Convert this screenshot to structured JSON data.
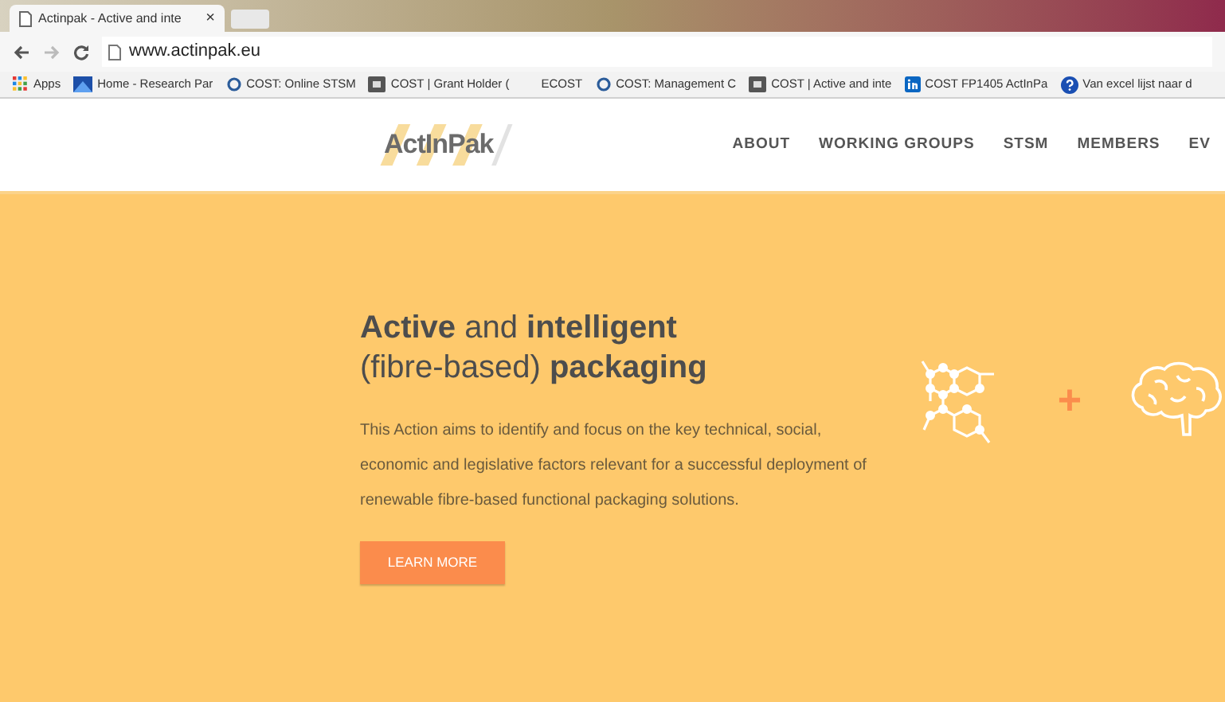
{
  "browser": {
    "tab": {
      "title": "Actinpak - Active and inte",
      "close": "×"
    },
    "url": "www.actinpak.eu",
    "bookmarks": [
      {
        "label": "Apps",
        "kind": "apps"
      },
      {
        "label": "Home - Research Par",
        "kind": "blue"
      },
      {
        "label": "COST: Online STSM",
        "kind": "ring"
      },
      {
        "label": "COST | Grant Holder (",
        "kind": "square"
      },
      {
        "label": "ECOST",
        "kind": "none"
      },
      {
        "label": "COST: Management C",
        "kind": "ring"
      },
      {
        "label": "COST | Active and inte",
        "kind": "square"
      },
      {
        "label": "COST FP1405 ActInPa",
        "kind": "linkedin"
      },
      {
        "label": "Van excel lijst naar d",
        "kind": "help"
      }
    ]
  },
  "site": {
    "logo": "ActInPak",
    "nav": [
      "ABOUT",
      "WORKING GROUPS",
      "STSM",
      "MEMBERS",
      "EV"
    ],
    "hero": {
      "title_line_1": "**Active** and **intelligent**",
      "title_line_2": "(fibre-based) **packaging**",
      "text": "This Action aims to identify and focus on the key technical, social, economic and legislative factors relevant for a successful deployment of renewable fibre-based functional packaging solutions.",
      "button": "LEARN MORE",
      "plus": "+"
    }
  }
}
